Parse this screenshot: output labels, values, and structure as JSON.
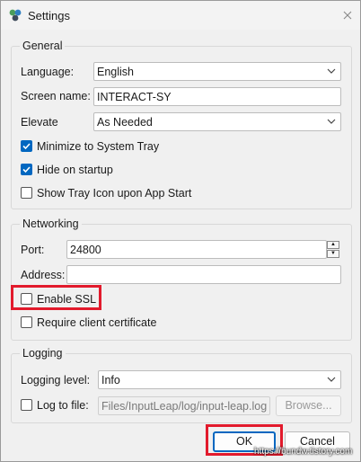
{
  "window": {
    "title": "Settings"
  },
  "general": {
    "title": "General",
    "language_label": "Language:",
    "language_value": "English",
    "screen_name_label": "Screen name:",
    "screen_name_value": "INTERACT-SY",
    "elevate_label": "Elevate",
    "elevate_value": "As Needed",
    "minimize_label": "Minimize to System Tray",
    "minimize_checked": true,
    "hide_label": "Hide on startup",
    "hide_checked": true,
    "tray_icon_label": "Show Tray Icon upon App Start",
    "tray_icon_checked": false
  },
  "networking": {
    "title": "Networking",
    "port_label": "Port:",
    "port_value": "24800",
    "address_label": "Address:",
    "address_value": "",
    "ssl_label": "Enable SSL",
    "ssl_checked": false,
    "cert_label": "Require client certificate",
    "cert_checked": false
  },
  "logging": {
    "title": "Logging",
    "level_label": "Logging level:",
    "level_value": "Info",
    "log_file_label": "Log to file:",
    "log_file_checked": false,
    "log_file_path": "Files/InputLeap/log/input-leap.log",
    "browse_label": "Browse..."
  },
  "buttons": {
    "ok": "OK",
    "cancel": "Cancel"
  },
  "watermark": "https://bundw.tistory.com",
  "colors": {
    "accent": "#0067c0",
    "highlight": "#e21a2c"
  },
  "icons": {
    "app": "input-leap-logo-icon",
    "close": "close-icon",
    "dropdown": "chevron-down-icon"
  }
}
